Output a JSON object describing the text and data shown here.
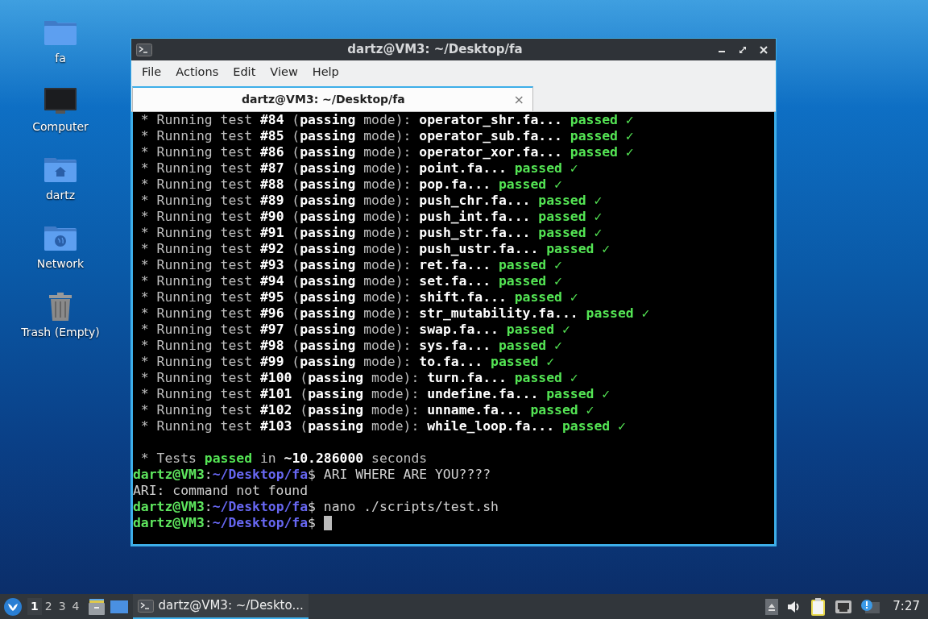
{
  "desktop_icons": [
    {
      "label": "fa",
      "kind": "folder"
    },
    {
      "label": "Computer",
      "kind": "computer"
    },
    {
      "label": "dartz",
      "kind": "home"
    },
    {
      "label": "Network",
      "kind": "network"
    },
    {
      "label": "Trash (Empty)",
      "kind": "trash"
    }
  ],
  "window": {
    "title": "dartz@VM3: ~/Desktop/fa",
    "menu": [
      "File",
      "Actions",
      "Edit",
      "View",
      "Help"
    ],
    "tabs": [
      {
        "label": "dartz@VM3: ~/Desktop/fa",
        "selected": true,
        "close": "×"
      }
    ],
    "terminal": [
      {
        "segments": [
          {
            "kind": "dim",
            "text": " * Running test "
          },
          {
            "kind": "bold",
            "text": "#84"
          },
          {
            "kind": "dim",
            "text": " ("
          },
          {
            "kind": "bold",
            "text": "passing"
          },
          {
            "kind": "dim",
            "text": " mode): "
          },
          {
            "kind": "bold",
            "text": "operator_shr.fa... "
          },
          {
            "kind": "green",
            "text": "passed"
          },
          {
            "kind": "check",
            "text": " ✓"
          }
        ]
      },
      {
        "segments": [
          {
            "kind": "dim",
            "text": " * Running test "
          },
          {
            "kind": "bold",
            "text": "#85"
          },
          {
            "kind": "dim",
            "text": " ("
          },
          {
            "kind": "bold",
            "text": "passing"
          },
          {
            "kind": "dim",
            "text": " mode): "
          },
          {
            "kind": "bold",
            "text": "operator_sub.fa... "
          },
          {
            "kind": "green",
            "text": "passed"
          },
          {
            "kind": "check",
            "text": " ✓"
          }
        ]
      },
      {
        "segments": [
          {
            "kind": "dim",
            "text": " * Running test "
          },
          {
            "kind": "bold",
            "text": "#86"
          },
          {
            "kind": "dim",
            "text": " ("
          },
          {
            "kind": "bold",
            "text": "passing"
          },
          {
            "kind": "dim",
            "text": " mode): "
          },
          {
            "kind": "bold",
            "text": "operator_xor.fa... "
          },
          {
            "kind": "green",
            "text": "passed"
          },
          {
            "kind": "check",
            "text": " ✓"
          }
        ]
      },
      {
        "segments": [
          {
            "kind": "dim",
            "text": " * Running test "
          },
          {
            "kind": "bold",
            "text": "#87"
          },
          {
            "kind": "dim",
            "text": " ("
          },
          {
            "kind": "bold",
            "text": "passing"
          },
          {
            "kind": "dim",
            "text": " mode): "
          },
          {
            "kind": "bold",
            "text": "point.fa... "
          },
          {
            "kind": "green",
            "text": "passed"
          },
          {
            "kind": "check",
            "text": " ✓"
          }
        ]
      },
      {
        "segments": [
          {
            "kind": "dim",
            "text": " * Running test "
          },
          {
            "kind": "bold",
            "text": "#88"
          },
          {
            "kind": "dim",
            "text": " ("
          },
          {
            "kind": "bold",
            "text": "passing"
          },
          {
            "kind": "dim",
            "text": " mode): "
          },
          {
            "kind": "bold",
            "text": "pop.fa... "
          },
          {
            "kind": "green",
            "text": "passed"
          },
          {
            "kind": "check",
            "text": " ✓"
          }
        ]
      },
      {
        "segments": [
          {
            "kind": "dim",
            "text": " * Running test "
          },
          {
            "kind": "bold",
            "text": "#89"
          },
          {
            "kind": "dim",
            "text": " ("
          },
          {
            "kind": "bold",
            "text": "passing"
          },
          {
            "kind": "dim",
            "text": " mode): "
          },
          {
            "kind": "bold",
            "text": "push_chr.fa... "
          },
          {
            "kind": "green",
            "text": "passed"
          },
          {
            "kind": "check",
            "text": " ✓"
          }
        ]
      },
      {
        "segments": [
          {
            "kind": "dim",
            "text": " * Running test "
          },
          {
            "kind": "bold",
            "text": "#90"
          },
          {
            "kind": "dim",
            "text": " ("
          },
          {
            "kind": "bold",
            "text": "passing"
          },
          {
            "kind": "dim",
            "text": " mode): "
          },
          {
            "kind": "bold",
            "text": "push_int.fa... "
          },
          {
            "kind": "green",
            "text": "passed"
          },
          {
            "kind": "check",
            "text": " ✓"
          }
        ]
      },
      {
        "segments": [
          {
            "kind": "dim",
            "text": " * Running test "
          },
          {
            "kind": "bold",
            "text": "#91"
          },
          {
            "kind": "dim",
            "text": " ("
          },
          {
            "kind": "bold",
            "text": "passing"
          },
          {
            "kind": "dim",
            "text": " mode): "
          },
          {
            "kind": "bold",
            "text": "push_str.fa... "
          },
          {
            "kind": "green",
            "text": "passed"
          },
          {
            "kind": "check",
            "text": " ✓"
          }
        ]
      },
      {
        "segments": [
          {
            "kind": "dim",
            "text": " * Running test "
          },
          {
            "kind": "bold",
            "text": "#92"
          },
          {
            "kind": "dim",
            "text": " ("
          },
          {
            "kind": "bold",
            "text": "passing"
          },
          {
            "kind": "dim",
            "text": " mode): "
          },
          {
            "kind": "bold",
            "text": "push_ustr.fa... "
          },
          {
            "kind": "green",
            "text": "passed"
          },
          {
            "kind": "check",
            "text": " ✓"
          }
        ]
      },
      {
        "segments": [
          {
            "kind": "dim",
            "text": " * Running test "
          },
          {
            "kind": "bold",
            "text": "#93"
          },
          {
            "kind": "dim",
            "text": " ("
          },
          {
            "kind": "bold",
            "text": "passing"
          },
          {
            "kind": "dim",
            "text": " mode): "
          },
          {
            "kind": "bold",
            "text": "ret.fa... "
          },
          {
            "kind": "green",
            "text": "passed"
          },
          {
            "kind": "check",
            "text": " ✓"
          }
        ]
      },
      {
        "segments": [
          {
            "kind": "dim",
            "text": " * Running test "
          },
          {
            "kind": "bold",
            "text": "#94"
          },
          {
            "kind": "dim",
            "text": " ("
          },
          {
            "kind": "bold",
            "text": "passing"
          },
          {
            "kind": "dim",
            "text": " mode): "
          },
          {
            "kind": "bold",
            "text": "set.fa... "
          },
          {
            "kind": "green",
            "text": "passed"
          },
          {
            "kind": "check",
            "text": " ✓"
          }
        ]
      },
      {
        "segments": [
          {
            "kind": "dim",
            "text": " * Running test "
          },
          {
            "kind": "bold",
            "text": "#95"
          },
          {
            "kind": "dim",
            "text": " ("
          },
          {
            "kind": "bold",
            "text": "passing"
          },
          {
            "kind": "dim",
            "text": " mode): "
          },
          {
            "kind": "bold",
            "text": "shift.fa... "
          },
          {
            "kind": "green",
            "text": "passed"
          },
          {
            "kind": "check",
            "text": " ✓"
          }
        ]
      },
      {
        "segments": [
          {
            "kind": "dim",
            "text": " * Running test "
          },
          {
            "kind": "bold",
            "text": "#96"
          },
          {
            "kind": "dim",
            "text": " ("
          },
          {
            "kind": "bold",
            "text": "passing"
          },
          {
            "kind": "dim",
            "text": " mode): "
          },
          {
            "kind": "bold",
            "text": "str_mutability.fa... "
          },
          {
            "kind": "green",
            "text": "passed"
          },
          {
            "kind": "check",
            "text": " ✓"
          }
        ]
      },
      {
        "segments": [
          {
            "kind": "dim",
            "text": " * Running test "
          },
          {
            "kind": "bold",
            "text": "#97"
          },
          {
            "kind": "dim",
            "text": " ("
          },
          {
            "kind": "bold",
            "text": "passing"
          },
          {
            "kind": "dim",
            "text": " mode): "
          },
          {
            "kind": "bold",
            "text": "swap.fa... "
          },
          {
            "kind": "green",
            "text": "passed"
          },
          {
            "kind": "check",
            "text": " ✓"
          }
        ]
      },
      {
        "segments": [
          {
            "kind": "dim",
            "text": " * Running test "
          },
          {
            "kind": "bold",
            "text": "#98"
          },
          {
            "kind": "dim",
            "text": " ("
          },
          {
            "kind": "bold",
            "text": "passing"
          },
          {
            "kind": "dim",
            "text": " mode): "
          },
          {
            "kind": "bold",
            "text": "sys.fa... "
          },
          {
            "kind": "green",
            "text": "passed"
          },
          {
            "kind": "check",
            "text": " ✓"
          }
        ]
      },
      {
        "segments": [
          {
            "kind": "dim",
            "text": " * Running test "
          },
          {
            "kind": "bold",
            "text": "#99"
          },
          {
            "kind": "dim",
            "text": " ("
          },
          {
            "kind": "bold",
            "text": "passing"
          },
          {
            "kind": "dim",
            "text": " mode): "
          },
          {
            "kind": "bold",
            "text": "to.fa... "
          },
          {
            "kind": "green",
            "text": "passed"
          },
          {
            "kind": "check",
            "text": " ✓"
          }
        ]
      },
      {
        "segments": [
          {
            "kind": "dim",
            "text": " * Running test "
          },
          {
            "kind": "bold",
            "text": "#100"
          },
          {
            "kind": "dim",
            "text": " ("
          },
          {
            "kind": "bold",
            "text": "passing"
          },
          {
            "kind": "dim",
            "text": " mode): "
          },
          {
            "kind": "bold",
            "text": "turn.fa... "
          },
          {
            "kind": "green",
            "text": "passed"
          },
          {
            "kind": "check",
            "text": " ✓"
          }
        ]
      },
      {
        "segments": [
          {
            "kind": "dim",
            "text": " * Running test "
          },
          {
            "kind": "bold",
            "text": "#101"
          },
          {
            "kind": "dim",
            "text": " ("
          },
          {
            "kind": "bold",
            "text": "passing"
          },
          {
            "kind": "dim",
            "text": " mode): "
          },
          {
            "kind": "bold",
            "text": "undefine.fa... "
          },
          {
            "kind": "green",
            "text": "passed"
          },
          {
            "kind": "check",
            "text": " ✓"
          }
        ]
      },
      {
        "segments": [
          {
            "kind": "dim",
            "text": " * Running test "
          },
          {
            "kind": "bold",
            "text": "#102"
          },
          {
            "kind": "dim",
            "text": " ("
          },
          {
            "kind": "bold",
            "text": "passing"
          },
          {
            "kind": "dim",
            "text": " mode): "
          },
          {
            "kind": "bold",
            "text": "unname.fa... "
          },
          {
            "kind": "green",
            "text": "passed"
          },
          {
            "kind": "check",
            "text": " ✓"
          }
        ]
      },
      {
        "segments": [
          {
            "kind": "dim",
            "text": " * Running test "
          },
          {
            "kind": "bold",
            "text": "#103"
          },
          {
            "kind": "dim",
            "text": " ("
          },
          {
            "kind": "bold",
            "text": "passing"
          },
          {
            "kind": "dim",
            "text": " mode): "
          },
          {
            "kind": "bold",
            "text": "while_loop.fa... "
          },
          {
            "kind": "green",
            "text": "passed"
          },
          {
            "kind": "check",
            "text": " ✓"
          }
        ]
      },
      {
        "blank_line_before": true,
        "segments": [
          {
            "kind": "dim",
            "text": " * Tests "
          },
          {
            "kind": "green",
            "text": "passed"
          },
          {
            "kind": "dim",
            "text": " in "
          },
          {
            "kind": "bold",
            "text": "~10.286000"
          },
          {
            "kind": "dim",
            "text": " seconds"
          }
        ]
      },
      {
        "segments": [
          {
            "kind": "user",
            "text": "dartz@VM3"
          },
          {
            "kind": "plain",
            "text": ":"
          },
          {
            "kind": "path",
            "text": "~/Desktop/fa"
          },
          {
            "kind": "plain",
            "text": "$ ARI WHERE ARE YOU????"
          }
        ]
      },
      {
        "segments": [
          {
            "kind": "plain",
            "text": "ARI: command not found"
          }
        ]
      },
      {
        "segments": [
          {
            "kind": "user",
            "text": "dartz@VM3"
          },
          {
            "kind": "plain",
            "text": ":"
          },
          {
            "kind": "path",
            "text": "~/Desktop/fa"
          },
          {
            "kind": "plain",
            "text": "$ nano ./scripts/test.sh"
          }
        ]
      },
      {
        "cursor": true,
        "segments": [
          {
            "kind": "user",
            "text": "dartz@VM3"
          },
          {
            "kind": "plain",
            "text": ":"
          },
          {
            "kind": "path",
            "text": "~/Desktop/fa"
          },
          {
            "kind": "plain",
            "text": "$"
          }
        ]
      }
    ]
  },
  "taskbar": {
    "workspaces": [
      {
        "label": "1",
        "selected": true
      },
      {
        "label": "2",
        "selected": false
      },
      {
        "label": "3",
        "selected": false
      },
      {
        "label": "4",
        "selected": false
      }
    ],
    "tasks": [
      {
        "label": "dartz@VM3: ~/Deskto...",
        "selected": true
      }
    ],
    "clock": "7:27"
  }
}
